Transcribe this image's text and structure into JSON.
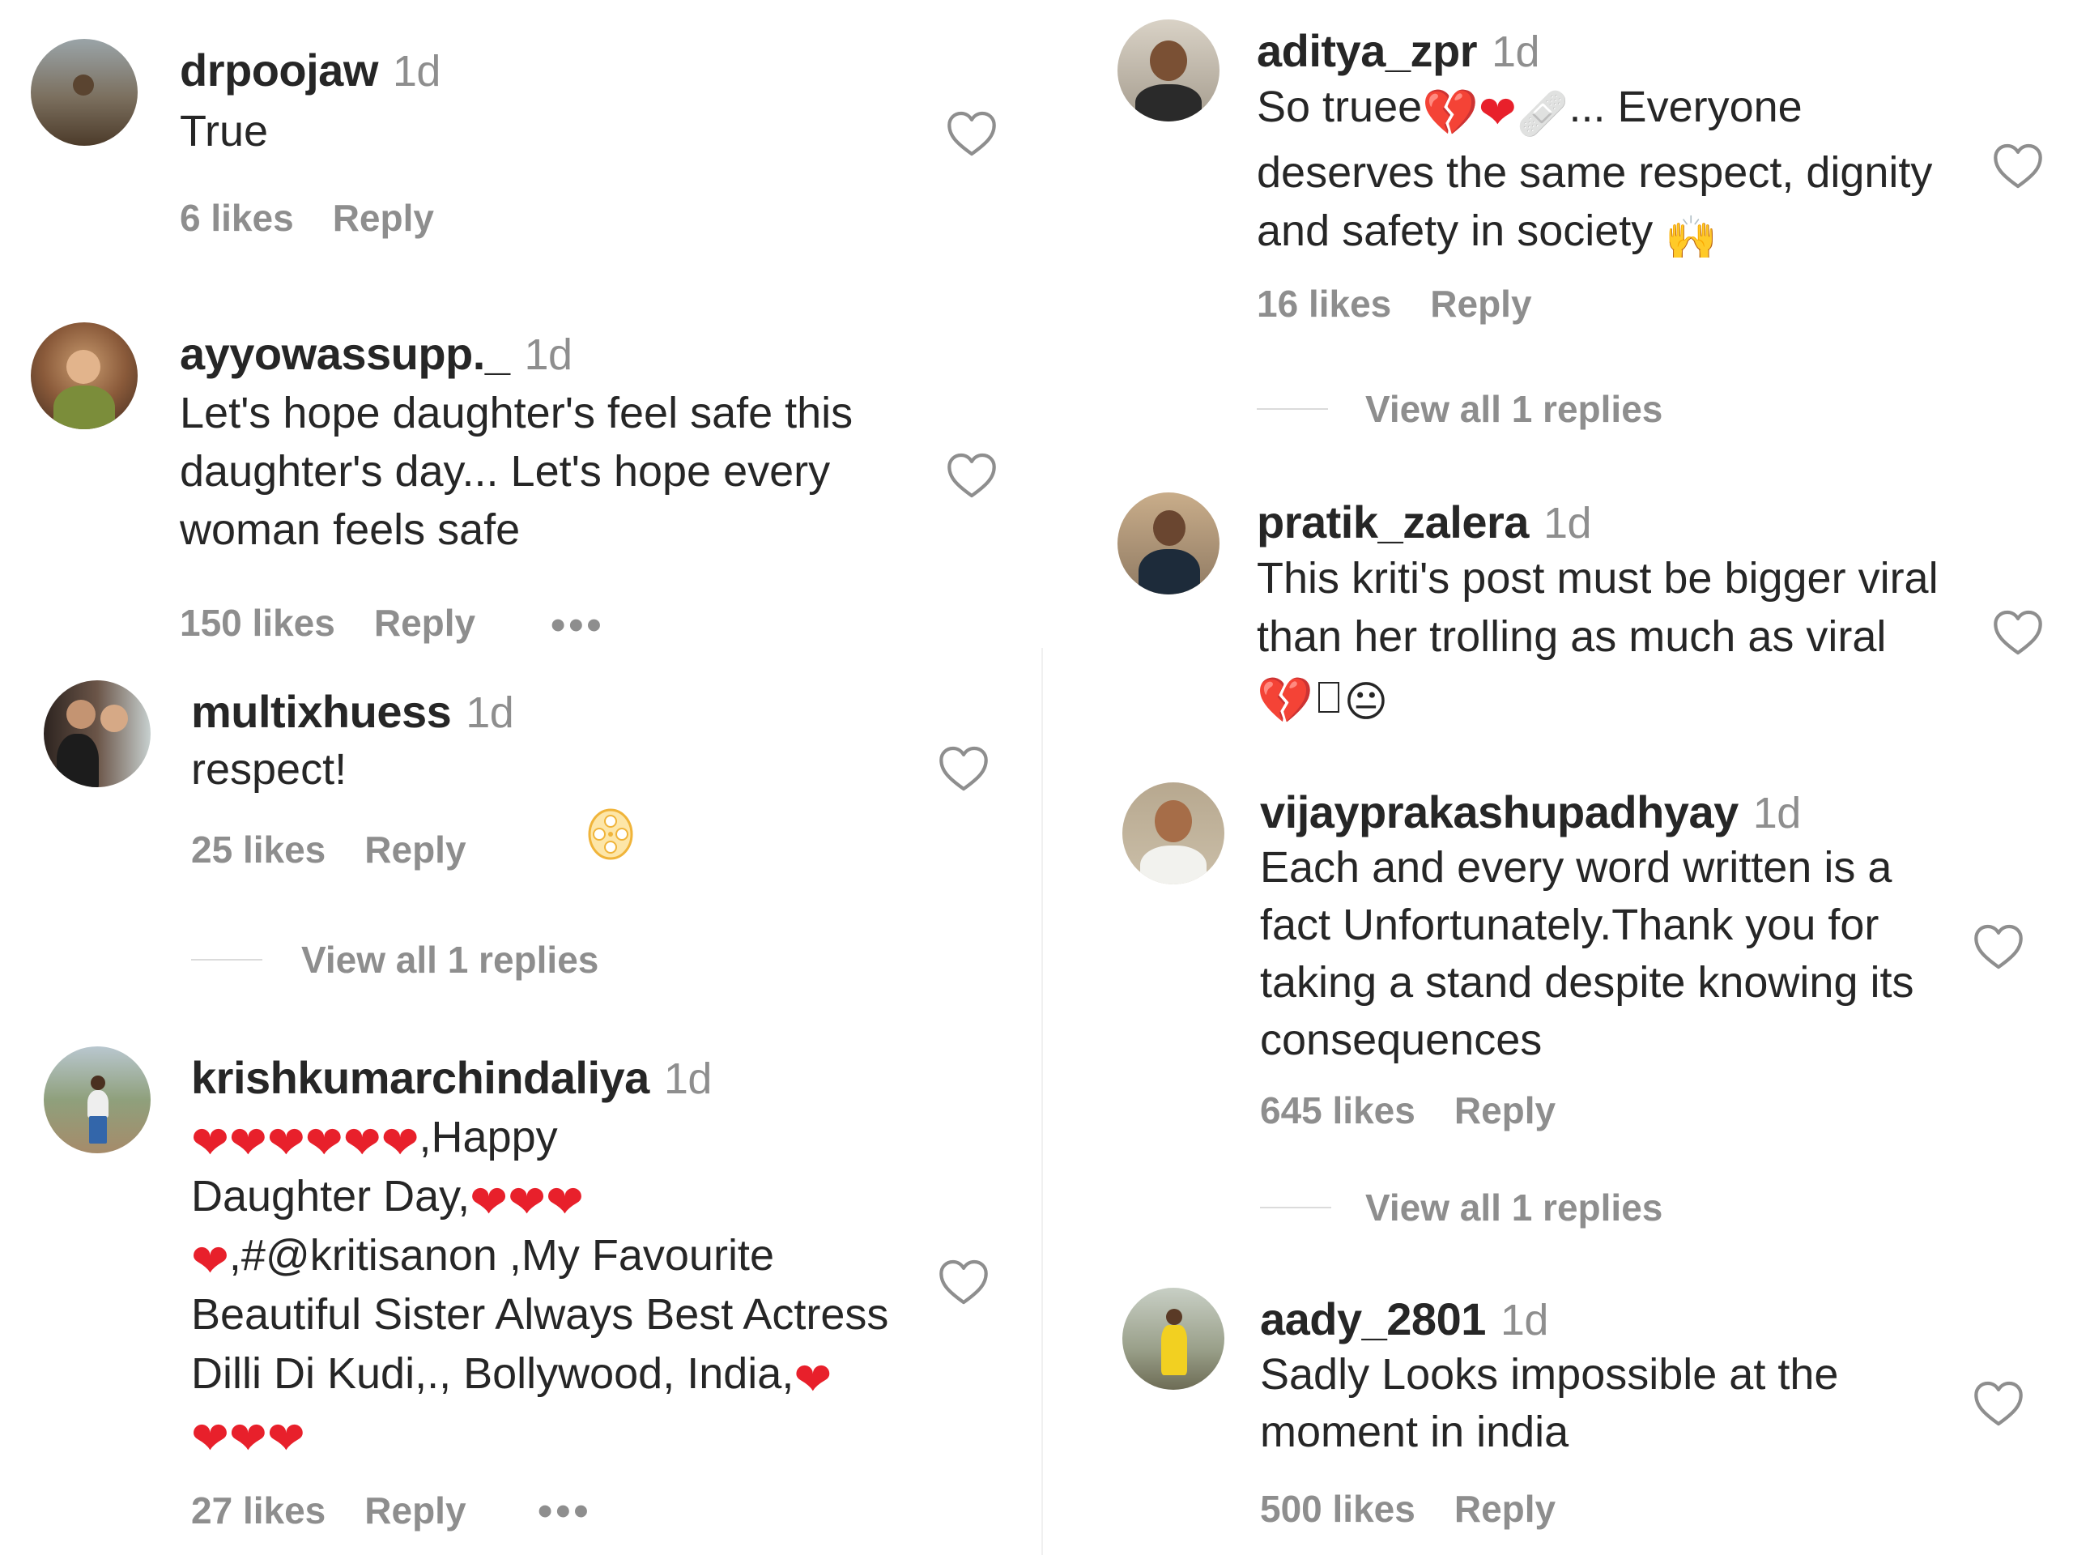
{
  "comments_left": [
    {
      "username": "drpoojaw",
      "time": "1d",
      "text": "True",
      "likes": "6 likes",
      "reply": "Reply"
    },
    {
      "username": "ayyowassupp._",
      "time": "1d",
      "text_lines": [
        "Let's hope daughter's feel safe this",
        "daughter's day... Let's hope every",
        "woman feels safe"
      ],
      "likes": "150 likes",
      "reply": "Reply",
      "more": "•••"
    },
    {
      "username": "multixhuess",
      "time": "1d",
      "text": "respect!",
      "likes": "25 likes",
      "reply": "Reply",
      "view_replies": "View all 1 replies"
    },
    {
      "username": "krishkumarchindaliya",
      "time": "1d",
      "line1_suffix": ",Happy",
      "line2_prefix": "Daughter Day,",
      "line3_suffix": ",#@kritisanon ,My Favourite",
      "line4": "Beautiful Sister Always Best Actress",
      "line5_prefix": "Dilli Di Kudi,., Bollywood, India,",
      "likes": "27 likes",
      "reply": "Reply",
      "more": "•••"
    }
  ],
  "comments_right": [
    {
      "username": "aditya_zpr",
      "time": "1d",
      "line1_prefix": "So truee",
      "line1_suffix": "... Everyone",
      "line2": "deserves the same respect, dignity",
      "line3_prefix": "and safety in society",
      "likes": "16 likes",
      "reply": "Reply",
      "view_replies": "View all 1 replies"
    },
    {
      "username": "pratik_zalera",
      "time": "1d",
      "text_lines": [
        "This kriti's post must be bigger viral",
        "than her trolling as much as viral"
      ],
      "likes": "",
      "reply": ""
    },
    {
      "username": "vijayprakashupadhyay",
      "time": "1d",
      "text_lines": [
        "Each and every word written is a",
        "fact Unfortunately.Thank you for",
        "taking a stand despite knowing its",
        "consequences"
      ],
      "likes": "645 likes",
      "reply": "Reply",
      "view_replies": "View all 1 replies"
    },
    {
      "username": "aady_2801",
      "time": "1d",
      "text_lines": [
        "Sadly Looks impossible at the",
        "moment in india"
      ],
      "likes": "500 likes",
      "reply": "Reply"
    }
  ],
  "icons": {
    "like": "heart-outline-icon",
    "emoji_heart": "red-heart-emoji",
    "emoji_broken": "broken-heart-emoji",
    "emoji_bandage": "bandage-emoji",
    "emoji_hands": "raised-hands-emoji",
    "emoji_neutral": "neutral-face-emoji",
    "film_reel": "film-reel-icon"
  },
  "colors": {
    "text": "#262626",
    "muted": "#8e8e8e",
    "heart_emoji": "#e8202b"
  }
}
